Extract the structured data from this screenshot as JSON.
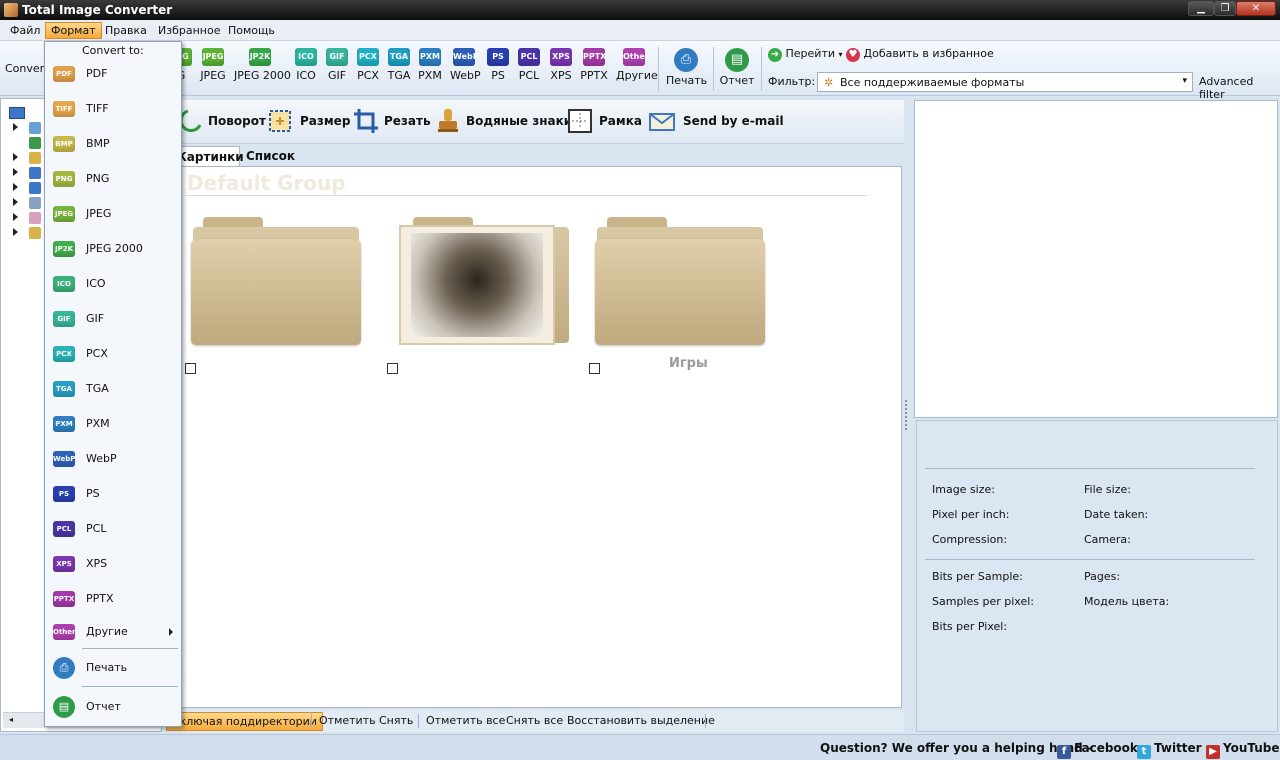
{
  "window": {
    "title": "Total Image Converter",
    "minimize": "▁",
    "maximize": "❐",
    "close": "✕"
  },
  "menu": [
    "Файл",
    "Формат",
    "Правка",
    "Избранное",
    "Помощь"
  ],
  "toolbar": {
    "convert_label": "Convert",
    "formats": [
      {
        "label": "G",
        "color": "#5bb336",
        "icon": "jpeg-icon"
      },
      {
        "label": "JPEG",
        "color": "#5bb336",
        "icon": "jpeg-icon"
      },
      {
        "label": "JPEG 2000",
        "color": "#37a848",
        "icon": "jp2k-icon"
      },
      {
        "label": "ICO",
        "color": "#2bb5a2",
        "icon": "ico-icon"
      },
      {
        "label": "GIF",
        "color": "#38b59e",
        "icon": "gif-icon"
      },
      {
        "label": "PCX",
        "color": "#1fb0c7",
        "icon": "pcx-icon"
      },
      {
        "label": "TGA",
        "color": "#1e9fc4",
        "icon": "tga-icon"
      },
      {
        "label": "PXM",
        "color": "#2c7fc2",
        "icon": "pxm-icon"
      },
      {
        "label": "WebP",
        "color": "#2c5fb8",
        "icon": "webp-icon"
      },
      {
        "label": "PS",
        "color": "#2a3fb0",
        "icon": "ps-icon"
      },
      {
        "label": "PCL",
        "color": "#4a34a8",
        "icon": "pcl-icon"
      },
      {
        "label": "XPS",
        "color": "#7a35b0",
        "icon": "xps-icon"
      },
      {
        "label": "PPTX",
        "color": "#a53aa8",
        "icon": "pptx-icon"
      },
      {
        "label": "Другие",
        "color": "#b040b0",
        "icon": "other-icon"
      }
    ],
    "icon_texts": [
      "JPG",
      "JPEG",
      "JP2K",
      "ICO",
      "GIF",
      "PCX",
      "TGA",
      "PXM",
      "WebP",
      "PS",
      "PCL",
      "XPS",
      "PPTX",
      "Other"
    ],
    "print_label": "Печать",
    "report_label": "Отчет",
    "goto_label": "Перейти",
    "favorites_label": "Добавить в избранное",
    "filter_label": "Фильтр:",
    "filter_value": "Все поддерживаемые форматы",
    "advanced_filter": "Advanced filter"
  },
  "actions": [
    "Поворот",
    "Размер",
    "Резать",
    "Водяные знаки",
    "Рамка",
    "Send by e-mail"
  ],
  "tabs": [
    "Картинки",
    "Список"
  ],
  "content": {
    "group_title": "Default Group",
    "items": [
      {
        "label": ""
      },
      {
        "label": ""
      },
      {
        "label": "Игры"
      }
    ]
  },
  "bottom_bar": [
    "Включая поддиректории",
    "Отметить",
    "Снять",
    "Отметить все",
    "Снять все",
    "Восстановить выделение"
  ],
  "info": {
    "image_size": "Image size:",
    "file_size": "File size:",
    "pixel_per_inch": "Pixel per inch:",
    "date_taken": "Date taken:",
    "compression": "Compression:",
    "camera": "Camera:",
    "bits_per_sample": "Bits per Sample:",
    "pages": "Pages:",
    "samples_per_pixel": "Samples per pixel:",
    "color_model": "Модель цвета:",
    "bits_per_pixel": "Bits per Pixel:"
  },
  "status": {
    "question": "Question? We offer you a helping hand -",
    "facebook": "Facebook",
    "twitter": "Twitter",
    "youtube": "YouTube"
  },
  "dropdown": {
    "header": "Convert to:",
    "items": [
      {
        "label": "PDF",
        "icon_text": "PDF",
        "color": "#e4a04a"
      },
      {
        "label": "TIFF",
        "icon_text": "TIFF",
        "color": "#e4a84a"
      },
      {
        "label": "BMP",
        "icon_text": "BMP",
        "color": "#c8b94a"
      },
      {
        "label": "PNG",
        "icon_text": "PNG",
        "color": "#a5b840"
      },
      {
        "label": "JPEG",
        "icon_text": "JPEG",
        "color": "#79b43e"
      },
      {
        "label": "JPEG 2000",
        "icon_text": "JP2K",
        "color": "#42ad4b"
      },
      {
        "label": "ICO",
        "icon_text": "ICO",
        "color": "#3cb37a"
      },
      {
        "label": "GIF",
        "icon_text": "GIF",
        "color": "#39b59a"
      },
      {
        "label": "PCX",
        "icon_text": "PCX",
        "color": "#28b3b8"
      },
      {
        "label": "TGA",
        "icon_text": "TGA",
        "color": "#279fc4"
      },
      {
        "label": "PXM",
        "icon_text": "PXM",
        "color": "#2f80c2"
      },
      {
        "label": "WebP",
        "icon_text": "WebP",
        "color": "#2d62b8"
      },
      {
        "label": "PS",
        "icon_text": "PS",
        "color": "#2a40b0"
      },
      {
        "label": "PCL",
        "icon_text": "PCL",
        "color": "#4d35a8"
      },
      {
        "label": "XPS",
        "icon_text": "XPS",
        "color": "#7c36b0"
      },
      {
        "label": "PPTX",
        "icon_text": "PPTX",
        "color": "#a33aa8"
      }
    ],
    "other_label": "Другие",
    "other_icon_text": "Other",
    "print_label": "Печать",
    "report_label": "Отчет"
  }
}
